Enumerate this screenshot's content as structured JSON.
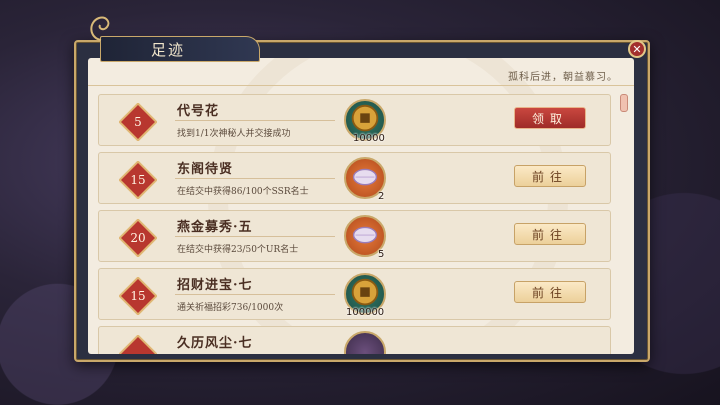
{
  "window": {
    "title": "足迹",
    "subtitle": "孤科后进，朝益慕习。"
  },
  "tasks": [
    {
      "level": "5",
      "title": "代号花",
      "desc": "找到1/1次神秘人并交接成功",
      "reward_type": "coin",
      "reward_count": "10000",
      "button": "领取",
      "button_type": "claim"
    },
    {
      "level": "15",
      "title": "东阁待贤",
      "desc": "在结交中获得86/100个SSR名士",
      "reward_type": "gem",
      "reward_count": "2",
      "button": "前往",
      "button_type": "goto"
    },
    {
      "level": "20",
      "title": "燕金募秀·五",
      "desc": "在结交中获得23/50个UR名士",
      "reward_type": "gem",
      "reward_count": "5",
      "button": "前往",
      "button_type": "goto"
    },
    {
      "level": "15",
      "title": "招财进宝·七",
      "desc": "通关祈福招彩736/1000次",
      "reward_type": "coin",
      "reward_count": "100000",
      "button": "前往",
      "button_type": "goto"
    },
    {
      "level": "",
      "title": "久历风尘·七",
      "desc": "",
      "reward_type": "gem",
      "reward_count": "",
      "button": "",
      "button_type": "goto"
    }
  ],
  "colors": {
    "claim": "#b23a33",
    "goto": "#f3dfb4",
    "frame": "#c9a86a"
  }
}
